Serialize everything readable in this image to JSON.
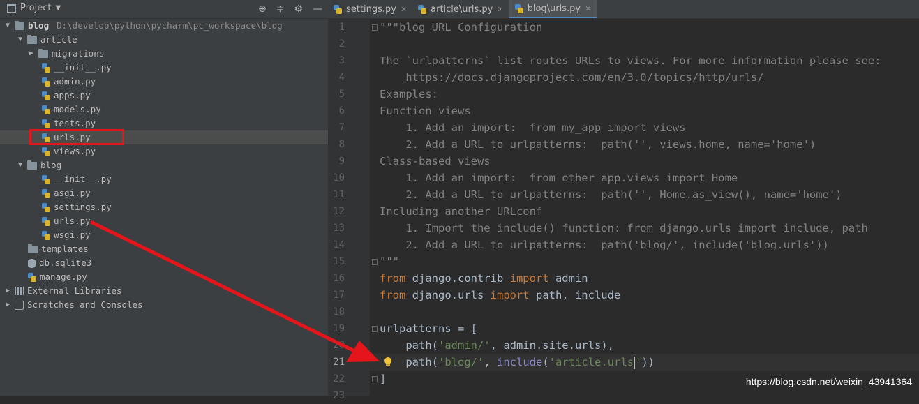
{
  "project_panel": {
    "title": "Project",
    "header_icons": [
      "locate-icon",
      "collapse-icon",
      "gear-icon",
      "hide-icon"
    ],
    "tree": [
      {
        "label": "blog",
        "extra": "D:\\develop\\python\\pycharm\\pc_workspace\\blog",
        "type": "folder",
        "expanded": true,
        "depth": 0
      },
      {
        "label": "article",
        "type": "folder",
        "expanded": true,
        "depth": 1
      },
      {
        "label": "migrations",
        "type": "folder",
        "expanded": false,
        "depth": 2
      },
      {
        "label": "__init__.py",
        "type": "py",
        "depth": 3
      },
      {
        "label": "admin.py",
        "type": "py",
        "depth": 3
      },
      {
        "label": "apps.py",
        "type": "py",
        "depth": 3
      },
      {
        "label": "models.py",
        "type": "py",
        "depth": 3
      },
      {
        "label": "tests.py",
        "type": "py",
        "depth": 3
      },
      {
        "label": "urls.py",
        "type": "py",
        "depth": 3,
        "highlighted": true
      },
      {
        "label": "views.py",
        "type": "py",
        "depth": 3
      },
      {
        "label": "blog",
        "type": "folder",
        "expanded": true,
        "depth": 1
      },
      {
        "label": "__init__.py",
        "type": "py",
        "depth": 3
      },
      {
        "label": "asgi.py",
        "type": "py",
        "depth": 3
      },
      {
        "label": "settings.py",
        "type": "py",
        "depth": 3
      },
      {
        "label": "urls.py",
        "type": "py",
        "depth": 3
      },
      {
        "label": "wsgi.py",
        "type": "py",
        "depth": 3
      },
      {
        "label": "templates",
        "type": "folder",
        "depth": 2
      },
      {
        "label": "db.sqlite3",
        "type": "db",
        "depth": 2
      },
      {
        "label": "manage.py",
        "type": "py",
        "depth": 2
      },
      {
        "label": "External Libraries",
        "type": "lib",
        "expanded": false,
        "depth": 0
      },
      {
        "label": "Scratches and Consoles",
        "type": "scratch",
        "expanded": false,
        "depth": 0
      }
    ]
  },
  "editor": {
    "tabs": [
      {
        "label": "settings.py",
        "active": false
      },
      {
        "label": "article\\urls.py",
        "active": false
      },
      {
        "label": "blog\\urls.py",
        "active": true
      }
    ],
    "current_line": 21,
    "lines": [
      "\"\"\"blog URL Configuration",
      "",
      "The `urlpatterns` list routes URLs to views. For more information please see:",
      "    https://docs.djangoproject.com/en/3.0/topics/http/urls/",
      "Examples:",
      "Function views",
      "    1. Add an import:  from my_app import views",
      "    2. Add a URL to urlpatterns:  path('', views.home, name='home')",
      "Class-based views",
      "    1. Add an import:  from other_app.views import Home",
      "    2. Add a URL to urlpatterns:  path('', Home.as_view(), name='home')",
      "Including another URLconf",
      "    1. Import the include() function: from django.urls import include, path",
      "    2. Add a URL to urlpatterns:  path('blog/', include('blog.urls'))",
      "\"\"\"",
      "from django.contrib import admin",
      "from django.urls import path, include",
      "",
      "urlpatterns = [",
      "    path('admin/', admin.site.urls),",
      "    path('blog/', include('article.urls'))",
      "]",
      ""
    ]
  },
  "watermark": "https://blog.csdn.net/weixin_43941364",
  "colors": {
    "annotation": "#e4151b",
    "keyword": "#cc7832",
    "string": "#6a8759",
    "docstring": "#808080"
  }
}
